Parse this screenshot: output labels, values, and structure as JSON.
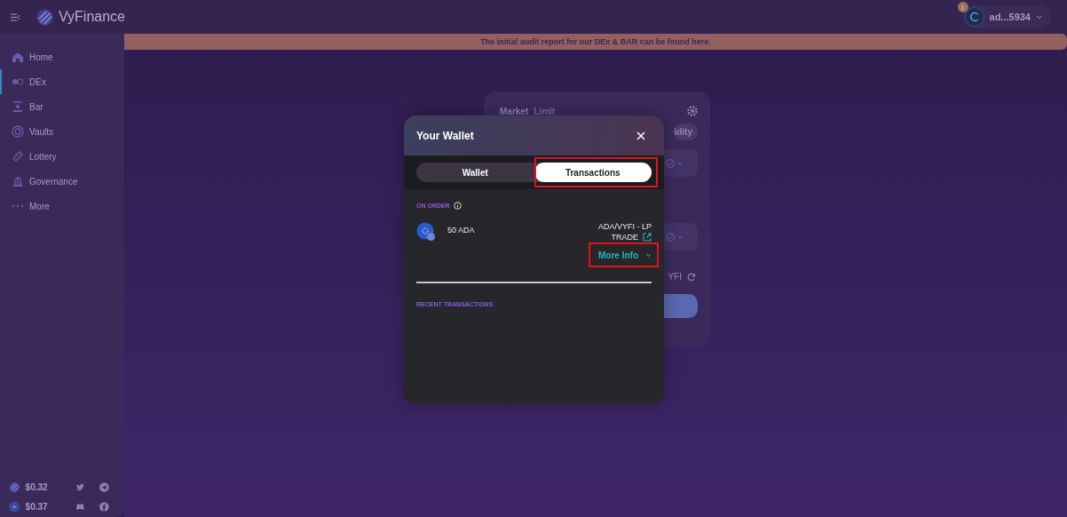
{
  "app": {
    "name": "VyFinance"
  },
  "account": {
    "badge": "1",
    "address": "ad...5934"
  },
  "banner": {
    "text": "The initial audit report for our DEx & BAR can be found here."
  },
  "sidebar": {
    "items": [
      {
        "label": "Home",
        "selected": false
      },
      {
        "label": "DEx",
        "selected": true
      },
      {
        "label": "Bar",
        "selected": false
      },
      {
        "label": "Vaults",
        "selected": false
      },
      {
        "label": "Lottery",
        "selected": false
      },
      {
        "label": "Governance",
        "selected": false
      },
      {
        "label": "More",
        "selected": false
      }
    ],
    "prices": [
      {
        "value": "$0.32"
      },
      {
        "value": "$0.37"
      }
    ]
  },
  "swap_card": {
    "tabs": [
      {
        "label": "Market",
        "selected": true
      },
      {
        "label": "Limit",
        "selected": false
      }
    ],
    "pill": "idity",
    "pair_text": "YFI"
  },
  "modal": {
    "title": "Your Wallet",
    "tabs": [
      {
        "label": "Wallet",
        "selected": false,
        "highlighted": false
      },
      {
        "label": "Transactions",
        "selected": true,
        "highlighted": true
      }
    ],
    "on_order": {
      "heading": "ON ORDER",
      "items": [
        {
          "amount": "50 ADA",
          "pair": "ADA/VYFI - LP",
          "type": "TRADE",
          "more": "More Info",
          "more_highlighted": true
        }
      ]
    },
    "recent": {
      "heading": "RECENT TRANSACTIONS"
    }
  }
}
